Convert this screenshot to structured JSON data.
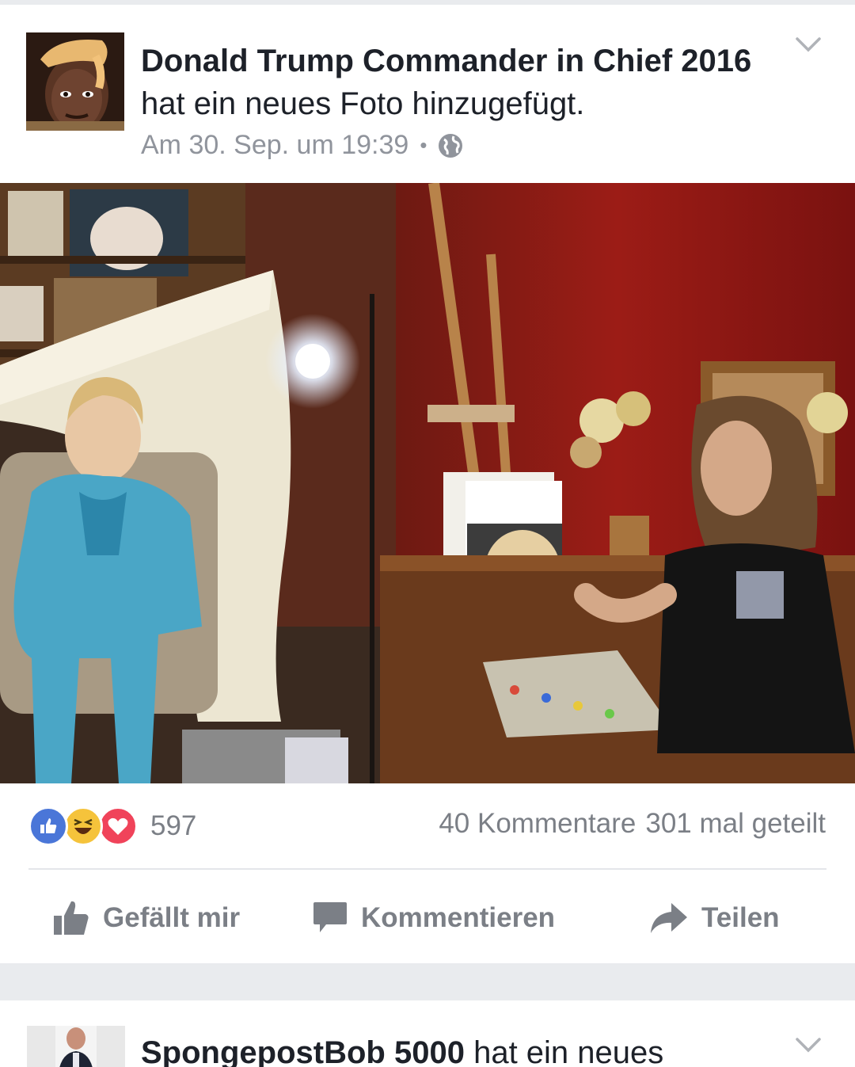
{
  "post1": {
    "author": "Donald Trump Commander in Chief 2016",
    "action_text": "hat ein neues Foto hinzugefügt.",
    "timestamp": "Am 30. Sep. um 19:39",
    "separator": "•",
    "privacy_icon": "globe-icon",
    "reactions": {
      "types": [
        "like",
        "haha",
        "love"
      ],
      "count": "597"
    },
    "comments": "40 Kommentare",
    "shares": "301 mal geteilt",
    "actions": {
      "like_label": "Gefällt mir",
      "comment_label": "Kommentieren",
      "share_label": "Teilen"
    }
  },
  "post2": {
    "author": "SpongepostBob 5000",
    "action_text": "hat ein neues"
  },
  "colors": {
    "like_blue": "#4a76d8",
    "haha_yellow": "#f5c33b",
    "love_red": "#f0435a",
    "muted_text": "#7b7f86",
    "feed_background": "#e9ebee"
  }
}
